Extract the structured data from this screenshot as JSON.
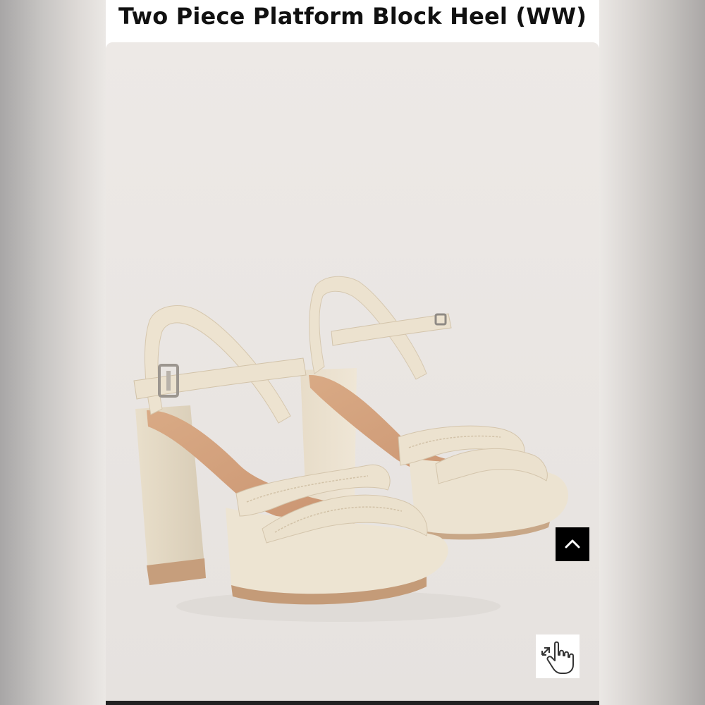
{
  "product": {
    "title": "Two Piece Platform Block Heel (WW)",
    "image_alt": "Cream two piece platform block heel sandals"
  },
  "controls": {
    "scroll_top_icon": "chevron-up-icon",
    "zoom_icon": "hand-pointer-expand-icon"
  },
  "colors": {
    "backdrop": "#ebe8e5",
    "shoe_cream": "#ece2cf",
    "footbed_tan": "#d4a27e",
    "button_dark": "#000000"
  }
}
